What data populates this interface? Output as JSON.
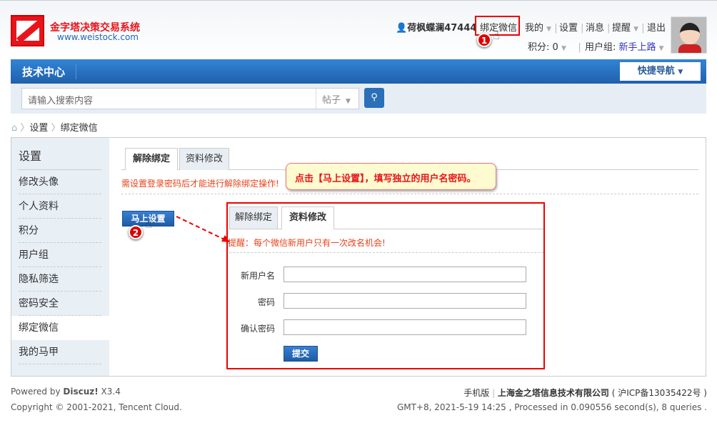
{
  "header": {
    "site_name": "金字塔决策交易系统",
    "site_url": "www.weistock.com",
    "username": "荷枫蝶澜47444",
    "links": [
      "绑定微信",
      "我的",
      "设置",
      "消息",
      "提醒",
      "退出"
    ],
    "points_label": "积分: 0",
    "group_label": "用户组: ",
    "group_value": "新手上路",
    "step1": "1"
  },
  "nav": {
    "title": "技术中心",
    "quick_nav": "快捷导航"
  },
  "search": {
    "placeholder": "请输入搜索内容",
    "type": "帖子"
  },
  "breadcrumb": [
    "设置",
    "绑定微信"
  ],
  "sidebar": {
    "title": "设置",
    "items": [
      "修改头像",
      "个人资料",
      "积分",
      "用户组",
      "隐私筛选",
      "密码安全",
      "绑定微信",
      "我的马甲"
    ]
  },
  "content": {
    "tabs": [
      "解除绑定",
      "资料修改"
    ],
    "notice": "需设置登录密码后才能进行解除绑定操作!",
    "set_button": "马上设置",
    "step2": "2",
    "tooltip": "点击【马上设置】，填写独立的用户名密码。",
    "popup": {
      "tabs": [
        "解除绑定",
        "资料修改"
      ],
      "reminder": "提醒：每个微信新用户只有一次改名机会!",
      "fields": [
        "新用户名",
        "密码",
        "确认密码"
      ],
      "submit": "提交"
    }
  },
  "footer": {
    "powered": "Powered by ",
    "discuz": "Discuz!",
    "version": " X3.4",
    "copyright": "Copyright © 2001-2021, Tencent Cloud.",
    "mobile": "手机版",
    "company": "上海金之塔信息技术有限公司",
    "icp": "( 沪ICP备13035422号 )",
    "stats": "GMT+8, 2021-5-19 14:25 , Processed in 0.090556 second(s), 8 queries ."
  }
}
